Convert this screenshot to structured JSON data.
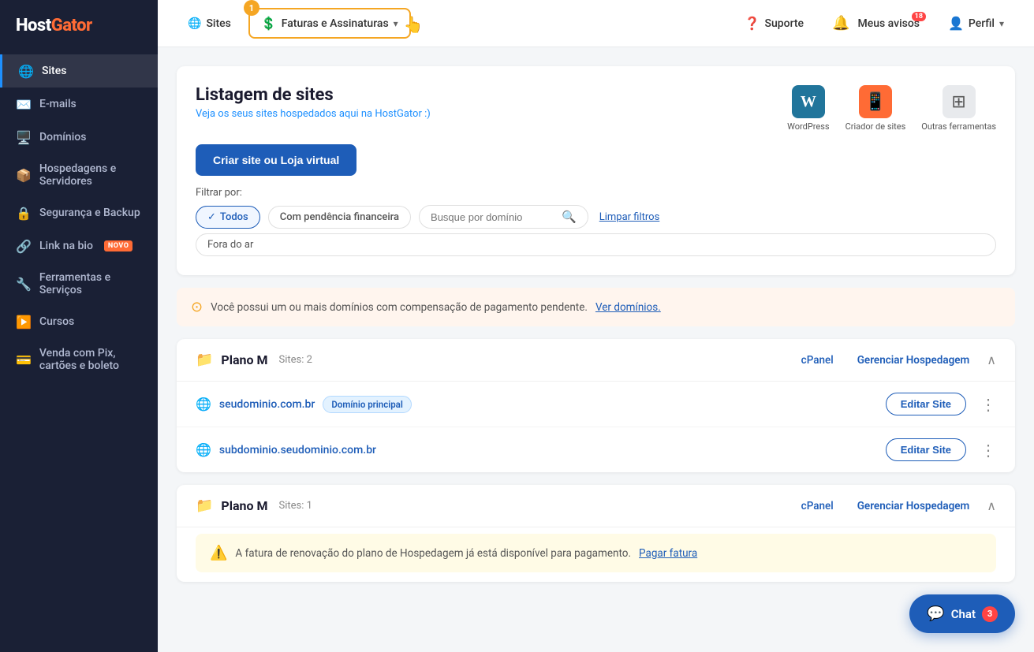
{
  "sidebar": {
    "logo": "HostGator",
    "items": [
      {
        "id": "sites",
        "label": "Sites",
        "icon": "🌐",
        "active": true,
        "badge": null
      },
      {
        "id": "emails",
        "label": "E-mails",
        "icon": "✉️",
        "active": false,
        "badge": null
      },
      {
        "id": "dominios",
        "label": "Domínios",
        "icon": "🖥️",
        "active": false,
        "badge": null
      },
      {
        "id": "hospedagens",
        "label": "Hospedagens e Servidores",
        "icon": "📦",
        "active": false,
        "badge": null
      },
      {
        "id": "seguranca",
        "label": "Segurança e Backup",
        "icon": "🔒",
        "active": false,
        "badge": null
      },
      {
        "id": "linkbio",
        "label": "Link na bio",
        "icon": "🔗",
        "active": false,
        "badge": "NOVO"
      },
      {
        "id": "ferramentas",
        "label": "Ferramentas e Serviços",
        "icon": "🔧",
        "active": false,
        "badge": null
      },
      {
        "id": "cursos",
        "label": "Cursos",
        "icon": "▶️",
        "active": false,
        "badge": null
      },
      {
        "id": "venda",
        "label": "Venda com Pix, cartões e boleto",
        "icon": "💳",
        "active": false,
        "badge": null
      }
    ]
  },
  "topnav": {
    "sites_label": "Sites",
    "faturas_label": "Faturas e Assinaturas",
    "suporte_label": "Suporte",
    "avisos_label": "Meus avisos",
    "notif_count": "18",
    "perfil_label": "Perfil",
    "step_number": "1"
  },
  "listagem": {
    "title": "Listagem de sites",
    "subtitle": "Veja os seus sites hospedados aqui na HostGator :)",
    "cta_label": "Criar site ou Loja virtual",
    "filter_label": "Filtrar por:",
    "filters": [
      {
        "id": "todos",
        "label": "Todos",
        "active": true
      },
      {
        "id": "pendencia",
        "label": "Com pendência financeira",
        "active": false
      },
      {
        "id": "fora",
        "label": "Fora do ar",
        "active": false
      }
    ],
    "search_placeholder": "Busque por domínio",
    "clear_filters_label": "Limpar filtros",
    "tools": [
      {
        "id": "wordpress",
        "label": "WordPress",
        "icon": "W"
      },
      {
        "id": "criador",
        "label": "Criador de sites",
        "icon": "📱"
      },
      {
        "id": "outras",
        "label": "Outras ferramentas",
        "icon": "⊞"
      }
    ]
  },
  "alert": {
    "message": "Você possui um ou mais domínios com compensação de pagamento pendente.",
    "link_label": "Ver domínios.",
    "icon": "⊙"
  },
  "plans": [
    {
      "id": "plan1",
      "name": "Plano M",
      "sites_count": "Sites: 2",
      "cpanel_label": "cPanel",
      "manage_label": "Gerenciar Hospedagem",
      "sites": [
        {
          "url": "seudominio.com.br",
          "is_main": true,
          "main_badge": "Domínio principal",
          "edit_label": "Editar Site"
        },
        {
          "url": "subdominio.seudominio.com.br",
          "is_main": false,
          "main_badge": null,
          "edit_label": "Editar Site"
        }
      ],
      "warning": null
    },
    {
      "id": "plan2",
      "name": "Plano M",
      "sites_count": "Sites: 1",
      "cpanel_label": "cPanel",
      "manage_label": "Gerenciar Hospedagem",
      "sites": [],
      "warning": {
        "message": "A fatura de renovação do plano de Hospedagem já está disponível para pagamento.",
        "link_label": "Pagar fatura"
      }
    }
  ],
  "chat": {
    "label": "Chat",
    "count": "3",
    "icon": "💬"
  }
}
